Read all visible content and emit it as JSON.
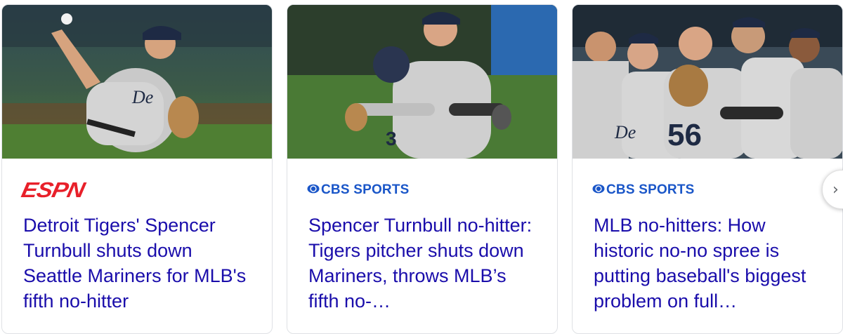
{
  "cards": [
    {
      "image": "pitcher-throwing-photo",
      "source": "ESPN",
      "headline": "Detroit Tigers' Spencer Turnbull shuts down Seattle Mariners for MLB's fifth no-hitter"
    },
    {
      "image": "players-embracing-photo",
      "source": "CBS SPORTS",
      "headline": "Spencer Turnbull no-hitter: Tigers pitcher shuts down Mariners, throws MLB’s fifth no-…"
    },
    {
      "image": "team-celebration-photo",
      "source": "CBS SPORTS",
      "headline": "MLB no-hitters: How historic no-no spree is putting baseball's biggest problem on full…"
    }
  ],
  "colors": {
    "link": "#1a0dab",
    "espn": "#e8202a",
    "cbs": "#1a56c8"
  },
  "next_icon": "chevron-right-icon"
}
